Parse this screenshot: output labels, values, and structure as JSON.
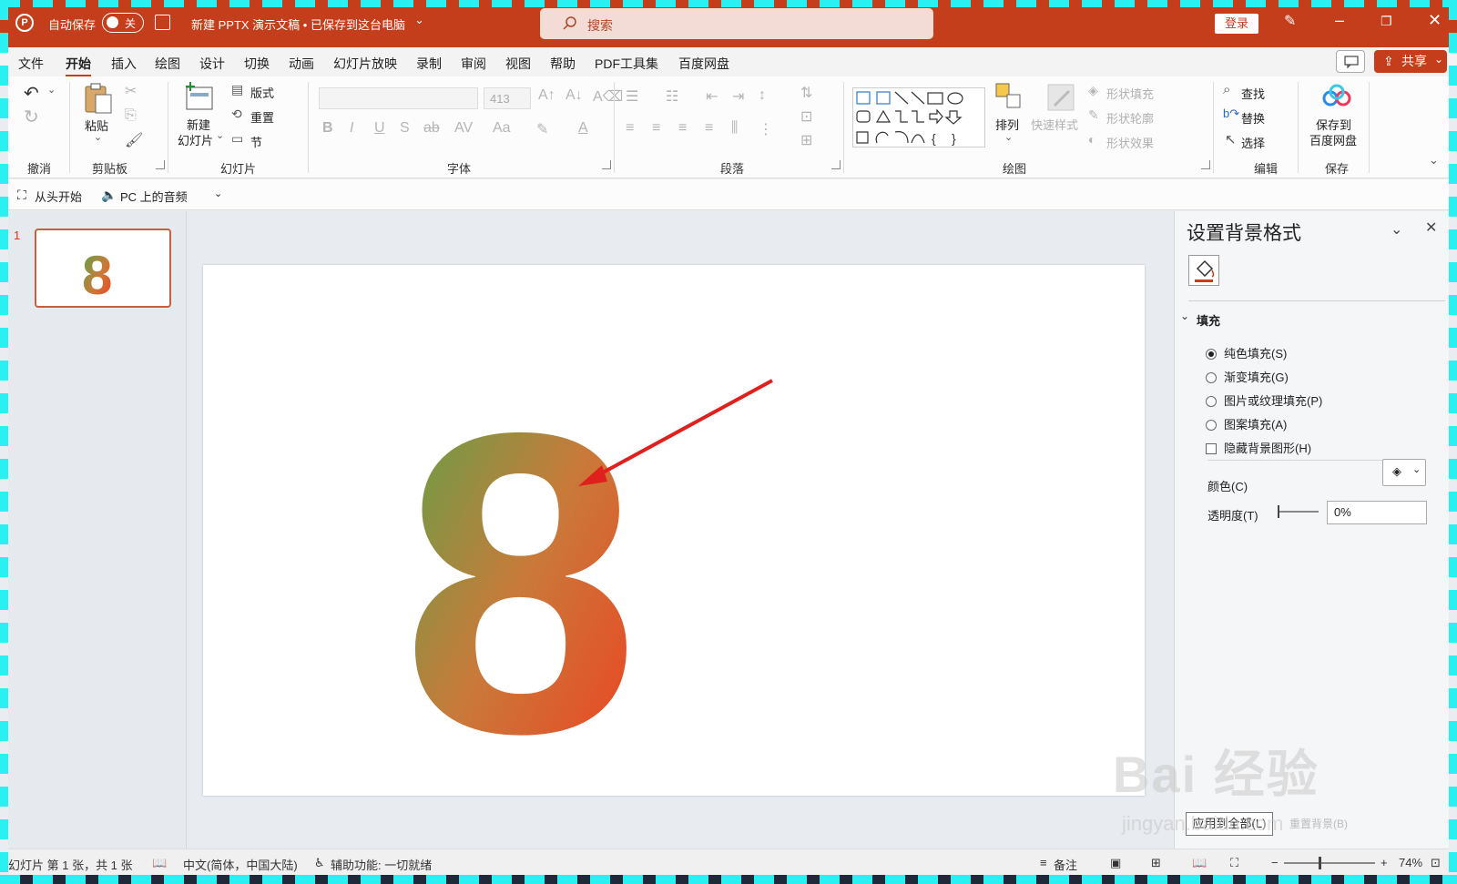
{
  "titlebar": {
    "autosave_label": "自动保存",
    "autosave_state": "关",
    "doc_title": "新建 PPTX 演示文稿 • 已保存到这台电脑",
    "search_placeholder": "搜索",
    "login": "登录",
    "accent": "#c43e1c"
  },
  "menu": {
    "tabs": [
      "文件",
      "开始",
      "插入",
      "绘图",
      "设计",
      "切换",
      "动画",
      "幻灯片放映",
      "录制",
      "审阅",
      "视图",
      "帮助",
      "PDF工具集",
      "百度网盘"
    ],
    "active_tab": "开始",
    "share": "共享"
  },
  "ribbon": {
    "groups": {
      "undo": "撤消",
      "clipboard": "剪贴板",
      "slides": "幻灯片",
      "font": "字体",
      "paragraph": "段落",
      "drawing": "绘图",
      "editing": "编辑",
      "save": "保存"
    },
    "paste": "粘贴",
    "new_slide": "新建",
    "new_slide_2": "幻灯片",
    "layout": "版式",
    "reset": "重置",
    "section": "节",
    "font_size": "413",
    "arrange": "排列",
    "quick_styles": "快速样式",
    "shape_fill": "形状填充",
    "shape_outline": "形状轮廓",
    "shape_effects": "形状效果",
    "find": "查找",
    "replace": "替换",
    "select": "选择",
    "save_to": "保存到",
    "baidu_disk": "百度网盘"
  },
  "qat": {
    "from_start": "从头开始",
    "pc_audio": "PC 上的音频"
  },
  "thumbnails": {
    "slide_number": "1",
    "glyph": "8"
  },
  "slide": {
    "glyph": "8",
    "gradient_start": "#4fa84a",
    "gradient_mid": "#c97a3a",
    "gradient_end": "#f23a1e",
    "arrow_color": "#e0201c"
  },
  "pane": {
    "title": "设置背景格式",
    "section": "填充",
    "options": [
      {
        "label": "纯色填充(S)",
        "checked": true
      },
      {
        "label": "渐变填充(G)",
        "checked": false
      },
      {
        "label": "图片或纹理填充(P)",
        "checked": false
      },
      {
        "label": "图案填充(A)",
        "checked": false
      }
    ],
    "hide_bg": "隐藏背景图形(H)",
    "color_label": "颜色(C)",
    "transparency_label": "透明度(T)",
    "transparency_value": "0%",
    "apply_all": "应用到全部(L)",
    "reset_bg": "重置背景(B)"
  },
  "status": {
    "slide_info": "幻灯片 第 1 张，共 1 张",
    "language": "中文(简体，中国大陆)",
    "accessibility": "辅助功能: 一切就绪",
    "notes": "备注",
    "zoom": "74%"
  },
  "watermark": {
    "brand": "Bai 经验",
    "url": "jingyan.baidu.com"
  }
}
